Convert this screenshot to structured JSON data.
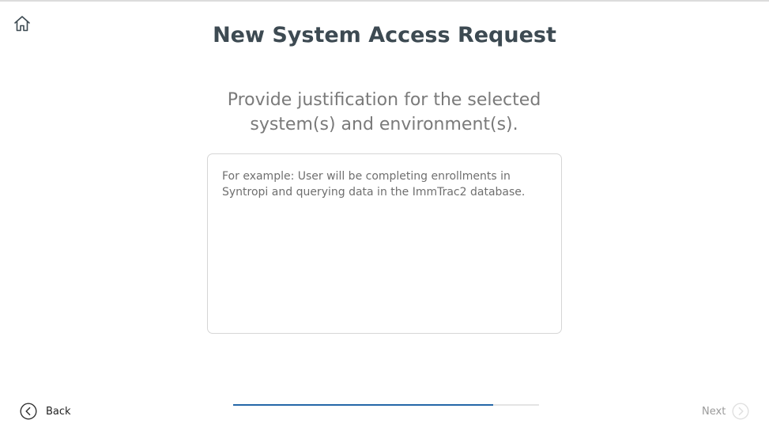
{
  "header": {
    "title": "New System Access Request",
    "home_icon": "home-icon"
  },
  "main": {
    "prompt_line1": "Provide justification for the selected",
    "prompt_line2": "system(s) and environment(s).",
    "justification": {
      "value": "",
      "placeholder": "For example: User will be completing enrollments in Syntropi and querying data in the ImmTrac2 database."
    }
  },
  "footer": {
    "back_label": "Back",
    "back_icon": "chevron-left-circle-icon",
    "next_label": "Next",
    "next_icon": "chevron-right-circle-icon",
    "next_enabled": false,
    "progress_fraction": 0.85
  },
  "colors": {
    "title": "#3d4a52",
    "progress": "#2467a8",
    "disabled": "#9a9a9a"
  }
}
